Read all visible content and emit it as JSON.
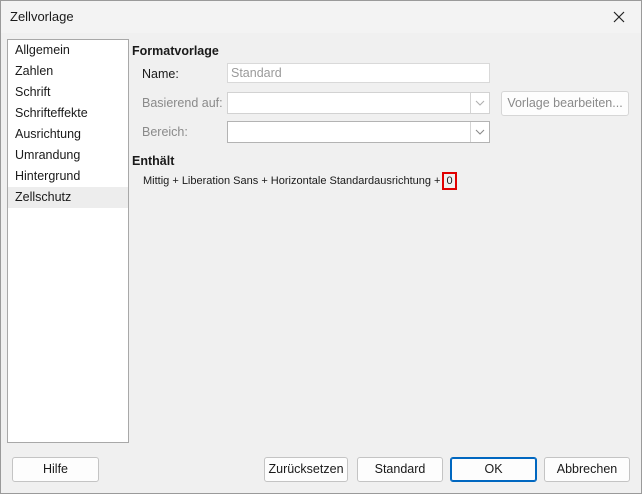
{
  "window": {
    "title": "Zellvorlage"
  },
  "sidebar": {
    "items": [
      {
        "label": "Allgemein"
      },
      {
        "label": "Zahlen"
      },
      {
        "label": "Schrift"
      },
      {
        "label": "Schrifteffekte"
      },
      {
        "label": "Ausrichtung"
      },
      {
        "label": "Umrandung"
      },
      {
        "label": "Hintergrund"
      },
      {
        "label": "Zellschutz"
      }
    ]
  },
  "formatvorlage": {
    "heading": "Formatvorlage",
    "name_label": "Name:",
    "name_value": "Standard",
    "basierend_label": "Basierend auf:",
    "basierend_value": "",
    "edit_button": "Vorlage bearbeiten...",
    "bereich_label": "Bereich:",
    "bereich_value": ""
  },
  "enthaelt": {
    "heading": "Enthält",
    "text": "Mittig + Liberation Sans + Horizontale Standardausrichtung +",
    "highlighted": "0"
  },
  "footer": {
    "help": "Hilfe",
    "reset": "Zurücksetzen",
    "standard": "Standard",
    "ok": "OK",
    "cancel": "Abbrechen"
  },
  "colors": {
    "highlight": "#e00000",
    "accent": "#0067c0"
  }
}
